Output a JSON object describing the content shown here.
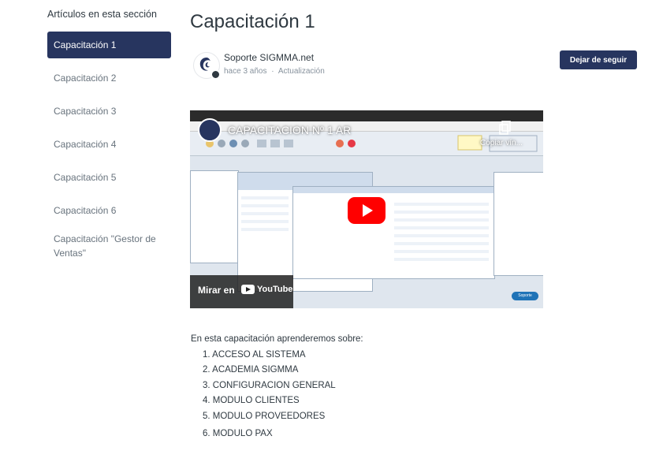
{
  "sidebar": {
    "title": "Artículos en esta sección",
    "items": [
      {
        "label": "Capacitación 1",
        "active": true
      },
      {
        "label": "Capacitación 2"
      },
      {
        "label": "Capacitación 3"
      },
      {
        "label": "Capacitación 4"
      },
      {
        "label": "Capacitación 5"
      },
      {
        "label": "Capacitación 6"
      },
      {
        "label": "Capacitación \"Gestor de Ventas\""
      }
    ]
  },
  "article": {
    "title": "Capacitación 1",
    "author": {
      "name": "Soporte SIGMMA.net",
      "time": "hace 3 años",
      "separator": "·",
      "status": "Actualización"
    },
    "follow_label": "Dejar de seguir",
    "video": {
      "title": "CAPACITACION Nº 1 AR",
      "copy_label": "Copiar vín...",
      "watch_label": "Mirar en",
      "youtube_label": "YouTube",
      "support_label": "Soporte"
    },
    "intro": "En esta capacitación aprenderemos sobre:",
    "topics": [
      "1. ACCESO AL SISTEMA",
      "2. ACADEMIA SIGMMA",
      "3. CONFIGURACION GENERAL",
      "4. MODULO CLIENTES",
      "5. MODULO PROVEEDORES",
      "6. MODULO PAX"
    ]
  },
  "colors": {
    "accent": "#27355f",
    "play": "#ff0000",
    "text": "#2f3941",
    "muted": "#87929d"
  }
}
